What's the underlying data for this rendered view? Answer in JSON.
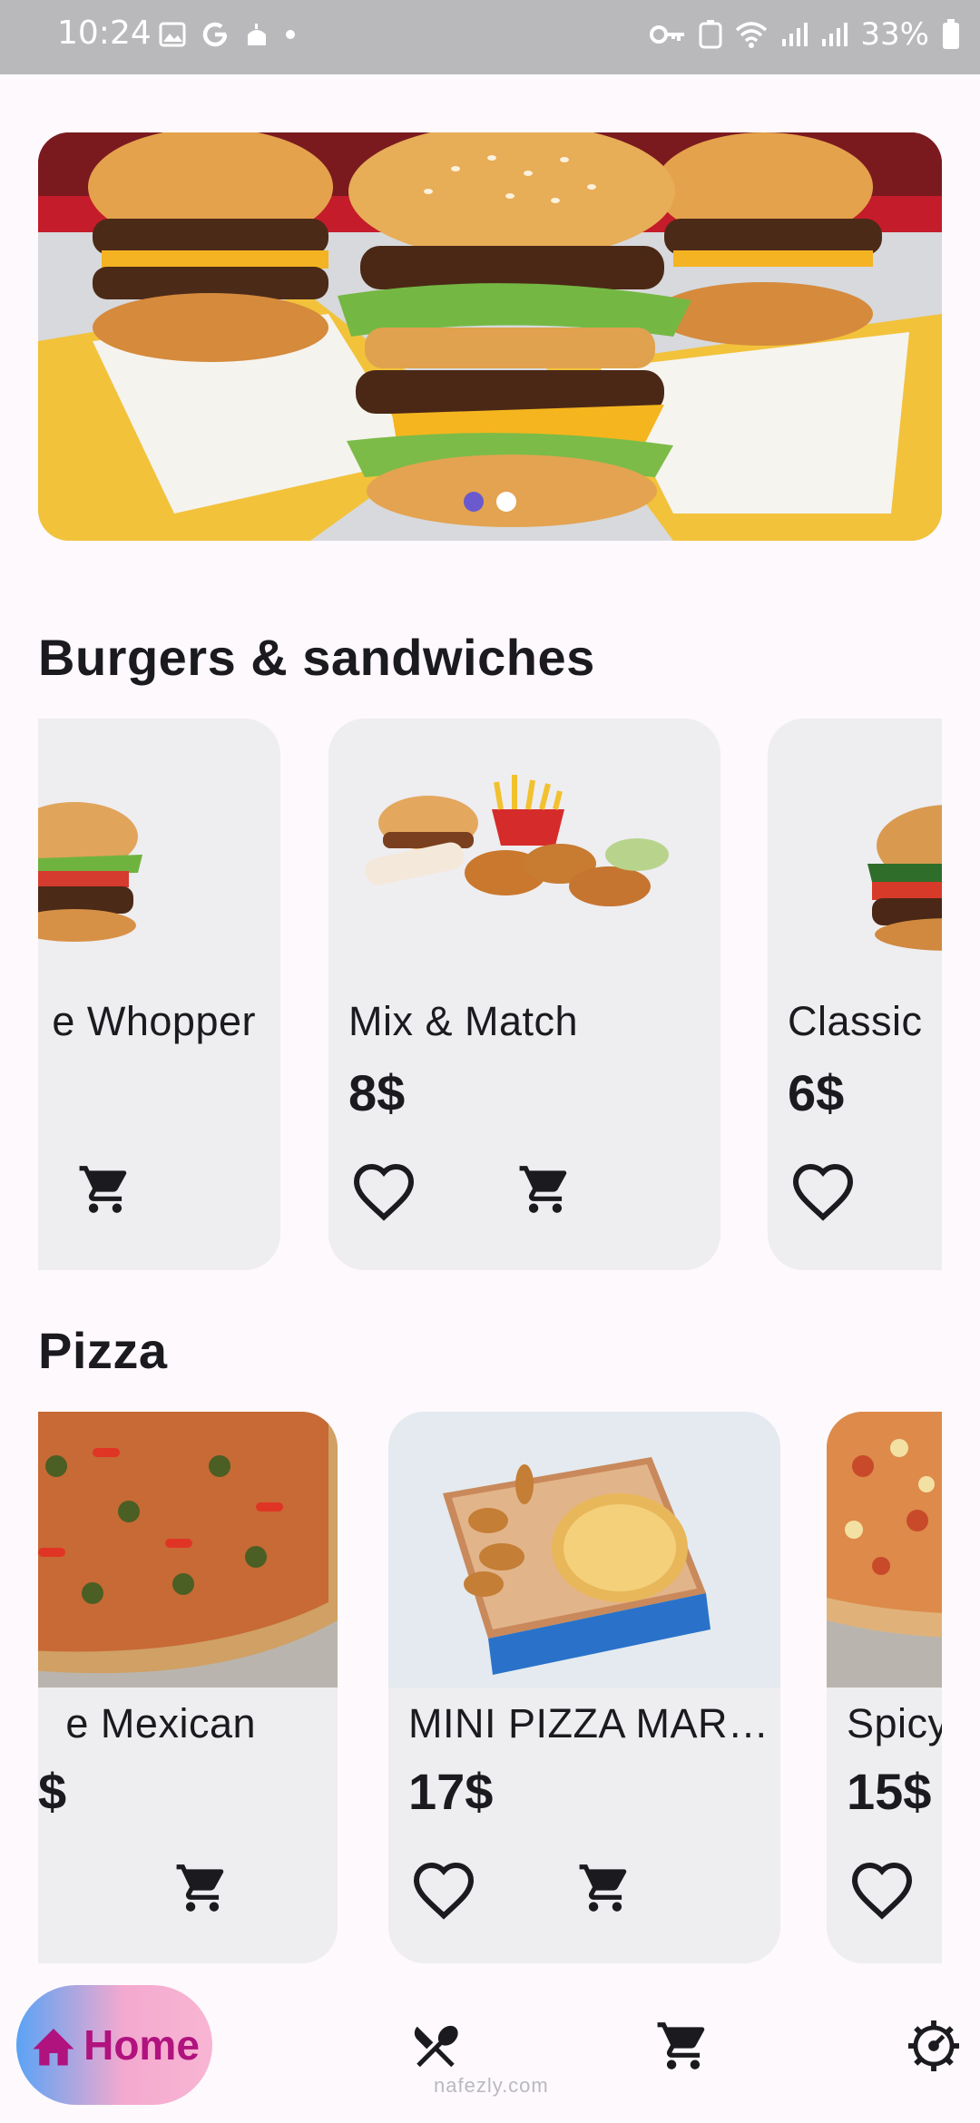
{
  "status_bar": {
    "time": "10:24",
    "battery": "33%"
  },
  "banner": {
    "image": "burgers-banner",
    "slide_count": 2,
    "active_slide": 1
  },
  "sections": [
    {
      "title": "Burgers & sandwiches",
      "items": [
        {
          "name": "e Whopper",
          "price": "",
          "favorite_visible": false
        },
        {
          "name": "Mix & Match",
          "price": "8$",
          "favorite_visible": true
        },
        {
          "name": "Classic",
          "price": "6$",
          "favorite_visible": true
        }
      ]
    },
    {
      "title": "Pizza",
      "items": [
        {
          "name": "e Mexican",
          "price": "$",
          "favorite_visible": false
        },
        {
          "name": "MINI PIZZA MAR…",
          "price": "17$",
          "favorite_visible": true
        },
        {
          "name": "Spicy",
          "price": "15$",
          "favorite_visible": true
        }
      ]
    }
  ],
  "bottom_nav": {
    "home_label": "Home",
    "items": [
      "home",
      "menu",
      "cart",
      "settings"
    ]
  },
  "watermark": "nafezly.com",
  "colors": {
    "accent": "#b0127e",
    "card_bg": "#eeedf0",
    "indicator_active": "#6a5acd"
  }
}
